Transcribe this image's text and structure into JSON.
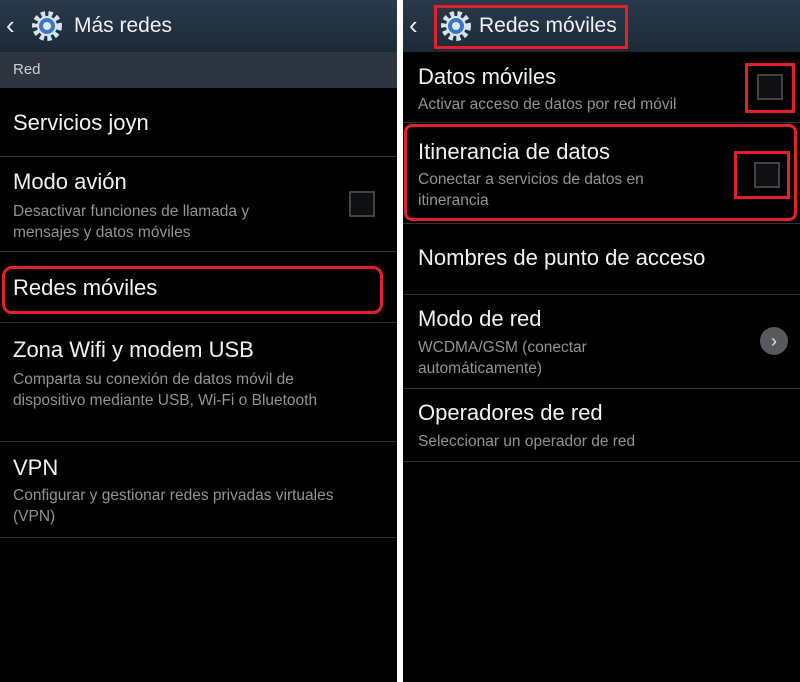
{
  "left": {
    "title": "Más redes",
    "section_header": "Red",
    "items": [
      {
        "title": "Servicios joyn"
      },
      {
        "title": "Modo avión",
        "summary": "Desactivar funciones de llamada y mensajes y datos móviles"
      },
      {
        "title": "Redes móviles"
      },
      {
        "title": "Zona Wifi y modem USB",
        "summary": "Comparta su conexión de datos móvil de dispositivo mediante USB, Wi-Fi o Bluetooth"
      },
      {
        "title": "VPN",
        "summary": "Configurar y gestionar redes privadas virtuales (VPN)"
      }
    ],
    "checkboxes": {
      "modo_avion": false
    }
  },
  "right": {
    "title": "Redes móviles",
    "items": [
      {
        "title": "Datos móviles",
        "summary": "Activar acceso de datos por red móvil"
      },
      {
        "title": "Itinerancia de datos",
        "summary": "Conectar a servicios de datos en itinerancia"
      },
      {
        "title": "Nombres de punto de acceso"
      },
      {
        "title": "Modo de red",
        "summary": "WCDMA/GSM (conectar automáticamente)"
      },
      {
        "title": "Operadores de red",
        "summary": "Seleccionar un operador de red"
      }
    ],
    "checkboxes": {
      "datos_moviles": false,
      "itinerancia": false
    }
  },
  "icons": {
    "back": "chevron-left-icon",
    "settings": "gear-icon",
    "more": "chevron-right-icon"
  },
  "colors": {
    "background": "#000000",
    "action_bar": "#24323f",
    "highlight": "#e3202b",
    "text": "#f2f2f2",
    "summary": "#8f9498"
  }
}
